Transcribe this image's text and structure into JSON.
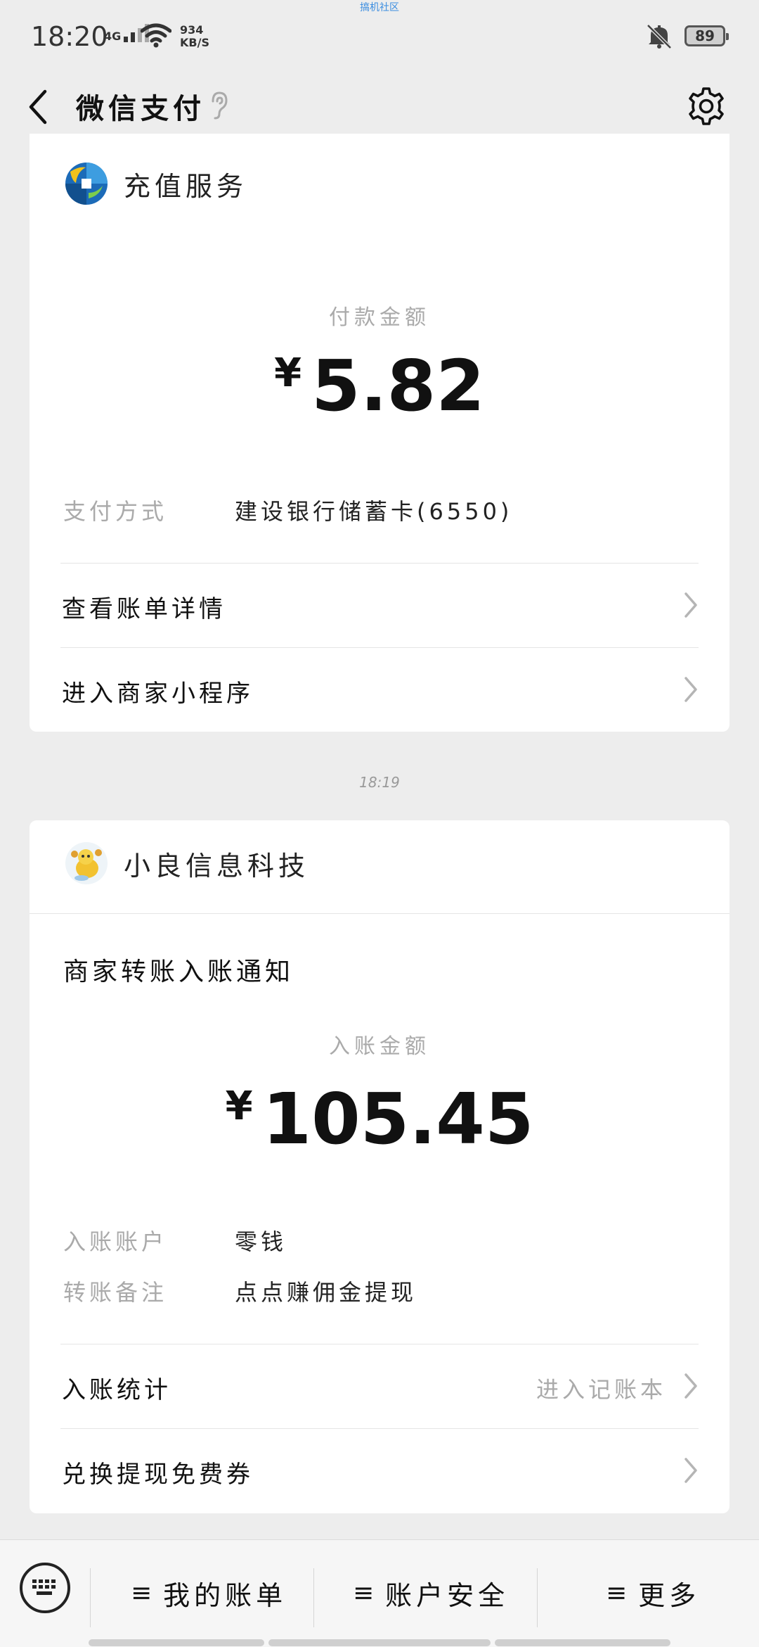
{
  "watermark": "搞机社区",
  "status_bar": {
    "time": "18:20",
    "network": "4G",
    "speed_value": "934",
    "speed_unit": "KB/S",
    "battery": "89"
  },
  "nav": {
    "title": "微信支付"
  },
  "card1": {
    "merchant_name": "充值服务",
    "amount_label": "付款金额",
    "currency": "¥",
    "amount": "5.82",
    "pay_method_label": "支付方式",
    "pay_method_value": "建设银行储蓄卡(6550)",
    "rows": [
      {
        "label": "查看账单详情"
      },
      {
        "label": "进入商家小程序"
      }
    ]
  },
  "timestamp": "18:19",
  "card2": {
    "merchant_name": "小良信息科技",
    "notice_title": "商家转账入账通知",
    "amount_label": "入账金额",
    "currency": "¥",
    "amount": "105.45",
    "details": [
      {
        "label": "入账账户",
        "value": "零钱"
      },
      {
        "label": "转账备注",
        "value": "点点赚佣金提现"
      }
    ],
    "rows": [
      {
        "label": "入账统计",
        "hint": "进入记账本"
      },
      {
        "label": "兑换提现免费券",
        "hint": ""
      }
    ]
  },
  "bottom_menu": {
    "items": [
      {
        "label": "我的账单"
      },
      {
        "label": "账户安全"
      },
      {
        "label": "更多"
      }
    ]
  }
}
